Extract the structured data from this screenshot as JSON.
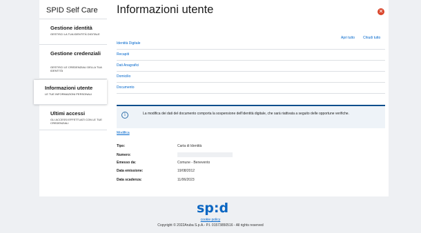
{
  "sidebar": {
    "brand": "SPID Self Care",
    "items": [
      {
        "title": "Gestione identità",
        "subtitle": "GESTISCI LA TUA IDENTITÀ DIGITALE"
      },
      {
        "title": "Gestione credenziali",
        "subtitle": "GESTISCI LE CREDENZIALI DELLA TUA IDENTITÀ"
      },
      {
        "title": "Informazioni utente",
        "subtitle": "LE TUE INFORMAZIONI PERSONALI"
      },
      {
        "title": "Ultimi accessi",
        "subtitle": "GLI ACCESSI EFFETTUATI CON LE TUE CREDENZIALI"
      }
    ]
  },
  "main": {
    "title": "Informazioni utente",
    "close_icon": "close-icon",
    "open_all": "Apri tutto",
    "close_all": "Chiudi tutto",
    "accordion": [
      "Identità Digitale",
      "Recapiti",
      "Dati Anagrafici",
      "Domicilio",
      "Documento"
    ],
    "alert": {
      "icon": "info-icon",
      "text": "La modifica dei dati del documento comporta la sospensione dell'identità digitale, che sarà riattivata a seguito delle opportune verifiche."
    },
    "modify": "Modifica",
    "fields": [
      {
        "label": "Tipo:",
        "value": "Carta di Identità"
      },
      {
        "label": "Numero:",
        "value": ""
      },
      {
        "label": "Emesso da:",
        "value": "Comune - Benevento"
      },
      {
        "label": "Data emissione:",
        "value": "19/08/2012"
      },
      {
        "label": "Data scadenza:",
        "value": "11/06/2023"
      }
    ]
  },
  "footer": {
    "logo": "sp:d",
    "cookie": "cookie policy",
    "copyright": "Copyright © 2022Aruba S.p.A.- P.I. 01573850516 - All rights reserved"
  },
  "colors": {
    "accent": "#0066cc",
    "alert_border": "#0a4d8c",
    "close": "#d9452b"
  }
}
